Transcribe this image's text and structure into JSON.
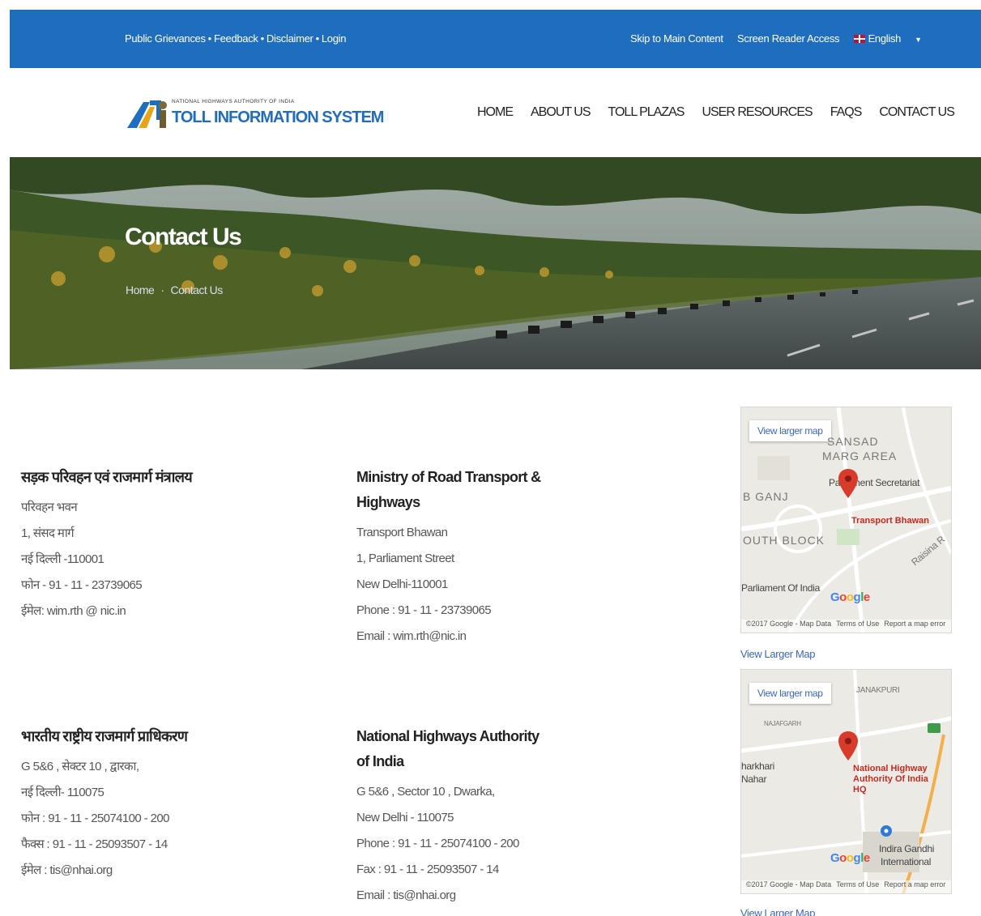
{
  "topbar": {
    "links": [
      "Public Grievances",
      "Feedback",
      "Disclaimer",
      "Login"
    ],
    "separator": "•",
    "skip": "Skip to Main Content",
    "screen_reader": "Screen Reader Access",
    "language": "English"
  },
  "logo": {
    "small": "NATIONAL HIGHWAYS AUTHORITY OF INDIA",
    "big": "TOLL INFORMATION SYSTEM"
  },
  "nav": [
    "HOME",
    "ABOUT US",
    "TOLL PLAZAS",
    "USER RESOURCES",
    "FAQS",
    "CONTACT US"
  ],
  "banner": {
    "title": "Contact Us",
    "breadcrumb": [
      "Home",
      "Contact Us"
    ]
  },
  "contacts": {
    "mort_hi": {
      "title": "सड़क परिवहन एवं राजमार्ग मंत्रालय",
      "lines": [
        "परिवहन भवन",
        "1, संसद मार्ग",
        "नई दिल्ली -110001",
        "फोन - 91 - 11 - 23739065",
        "ईमेल: wim.rth @ nic.in"
      ]
    },
    "mort_en": {
      "title": "Ministry of Road Transport & Highways",
      "lines": [
        "Transport Bhawan",
        "1, Parliament Street",
        "New Delhi-110001",
        "Phone : 91 - 11 - 23739065",
        "Email : wim.rth@nic.in"
      ]
    },
    "nhai_hi": {
      "title": "भारतीय राष्ट्रीय राजमार्ग प्राधिकरण",
      "lines": [
        "G 5&6 , सेक्टर 10 , द्वारका,",
        "नई दिल्ली- 110075",
        "फोन : 91 - 11 - 25074100 - 200",
        "फैक्स : 91 - 11 - 25093507 - 14",
        "ईमेल : tis@nhai.org"
      ]
    },
    "nhai_en": {
      "title": "National Highways Authority of India",
      "lines": [
        "G 5&6 , Sector 10 , Dwarka,",
        "New Delhi - 110075",
        "Phone : 91 - 11 - 25074100 - 200",
        "Fax : 91 - 11 - 25093507 - 14",
        "Email : tis@nhai.org"
      ]
    }
  },
  "map1": {
    "view_larger": "View larger map",
    "labels": [
      "SANSAD",
      "MARG AREA",
      "Parliament Secretariat",
      "B GANJ",
      "OUTH BLOCK",
      "Parliament Of India",
      "Raisina R"
    ],
    "pin_label": "Transport Bhawan",
    "footer": [
      "©2017 Google - Map Data",
      "Terms of Use",
      "Report a map error"
    ],
    "link": "View Larger Map"
  },
  "map2": {
    "view_larger": "View larger map",
    "labels": [
      "JANAKPURI",
      "NAJAFGARH",
      "harkhari",
      "Nahar",
      "Indira Gandhi",
      "International"
    ],
    "pin_label": "National Highway Authority Of India HQ",
    "footer": [
      "©2017 Google - Map Data",
      "Terms of Use",
      "Report a map error"
    ],
    "link": "View Larger Map"
  },
  "google": "Google",
  "colors": {
    "topbar": "#1f6dbf",
    "pin": "#d93b2b",
    "link": "#3a66c4"
  }
}
